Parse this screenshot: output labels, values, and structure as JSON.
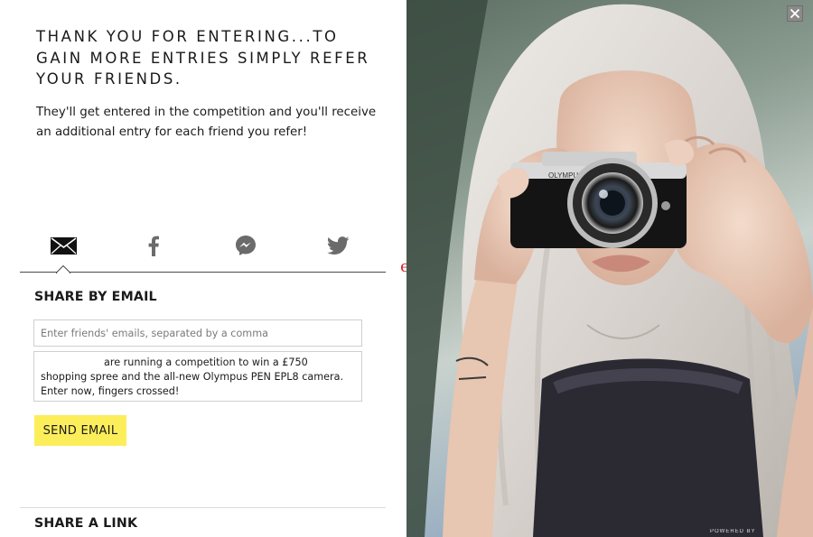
{
  "headline": "THANK YOU FOR ENTERING...TO GAIN MORE ENTRIES SIMPLY REFER YOUR FRIENDS.",
  "subtext": "They'll get entered in the competition and you'll receive an additional entry for each friend you refer!",
  "share_tabs": [
    {
      "name": "email",
      "icon": "envelope-icon",
      "active": true
    },
    {
      "name": "facebook",
      "icon": "facebook-icon",
      "active": false
    },
    {
      "name": "messenger",
      "icon": "messenger-icon",
      "active": false
    },
    {
      "name": "twitter",
      "icon": "twitter-icon",
      "active": false
    }
  ],
  "share_email": {
    "heading": "SHARE BY EMAIL",
    "emails_placeholder": "Enter friends' emails, separated by a comma",
    "message": "are running a competition to win a £750 shopping spree and the all-new Olympus PEN EPL8 camera. Enter now, fingers crossed!",
    "send_label": "SEND EMAIL"
  },
  "share_link": {
    "heading": "SHARE A LINK"
  },
  "stray_mark": "e",
  "photo": {
    "camera_brand_text": "OLYMPUS PEN",
    "powered_text": "POWERED BY"
  },
  "colors": {
    "button_yellow": "#fcee5b",
    "icon_gray": "#6b6b6b",
    "mark_red": "#d8282e",
    "close_gray": "#8a8a8a"
  },
  "close_icon": "close-icon"
}
